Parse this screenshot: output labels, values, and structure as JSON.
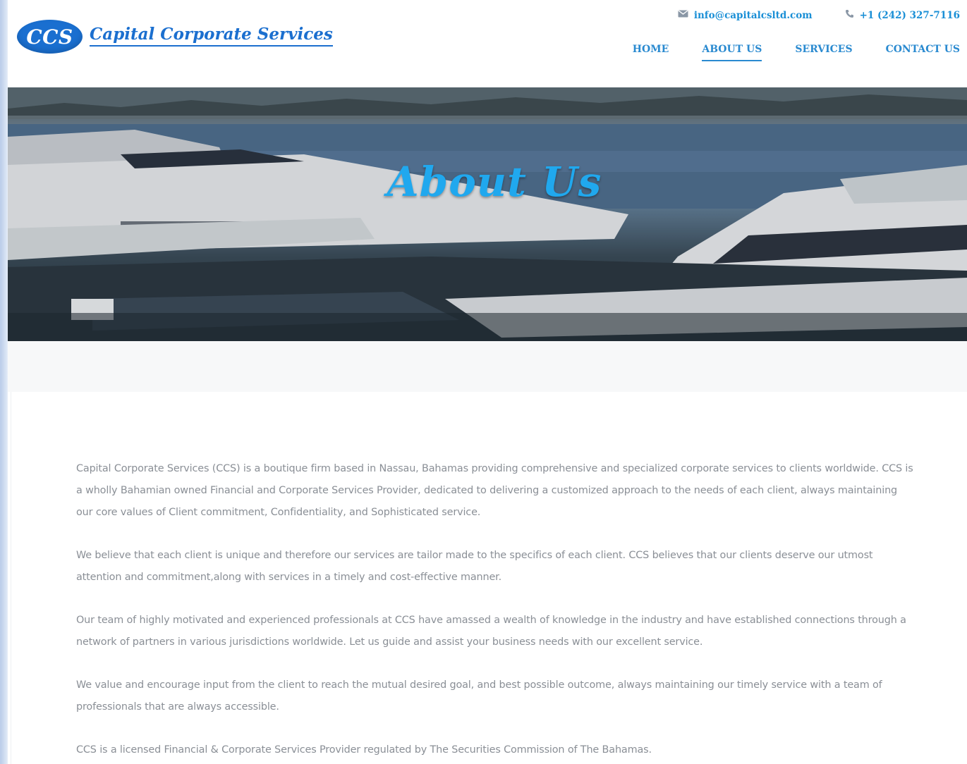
{
  "brand": {
    "logo_text": "CCS",
    "name": "Capital Corporate Services",
    "color": "#1b6fcf"
  },
  "contact": {
    "email_icon": "envelope-icon",
    "email": "info@capitalcsltd.com",
    "phone_icon": "phone-icon",
    "phone": "+1 (242) 327-7116"
  },
  "nav": {
    "items": [
      {
        "label": "HOME",
        "active": false
      },
      {
        "label": "ABOUT US",
        "active": true
      },
      {
        "label": "SERVICES",
        "active": false
      },
      {
        "label": "CONTACT US",
        "active": false
      }
    ],
    "color": "#2a8ad0"
  },
  "hero": {
    "title": "About Us",
    "title_color": "#20a8ee"
  },
  "content": {
    "paragraphs": [
      "Capital Corporate Services (CCS) is a boutique firm based in Nassau, Bahamas providing comprehensive and specialized corporate services to clients worldwide. CCS is a wholly Bahamian owned Financial and Corporate Services Provider, dedicated to delivering a customized approach to the needs of each client, always maintaining our core values of Client commitment, Confidentiality, and Sophisticated service.",
      "We believe that each client is unique and therefore our services are tailor made to the specifics of each client. CCS believes that our clients deserve our utmost attention and commitment,along with services in a timely and cost-effective manner.",
      "Our team of highly motivated and experienced professionals at CCS have amassed a wealth of knowledge in the industry and have established connections through a network of partners in various jurisdictions worldwide. Let us guide and assist your business needs with our excellent service.",
      "We value and encourage input from the client to reach the mutual desired goal, and best possible outcome, always maintaining our timely service with a team of professionals that are always accessible.",
      "CCS is a licensed Financial & Corporate Services Provider regulated by The Securities Commission of The Bahamas."
    ]
  }
}
